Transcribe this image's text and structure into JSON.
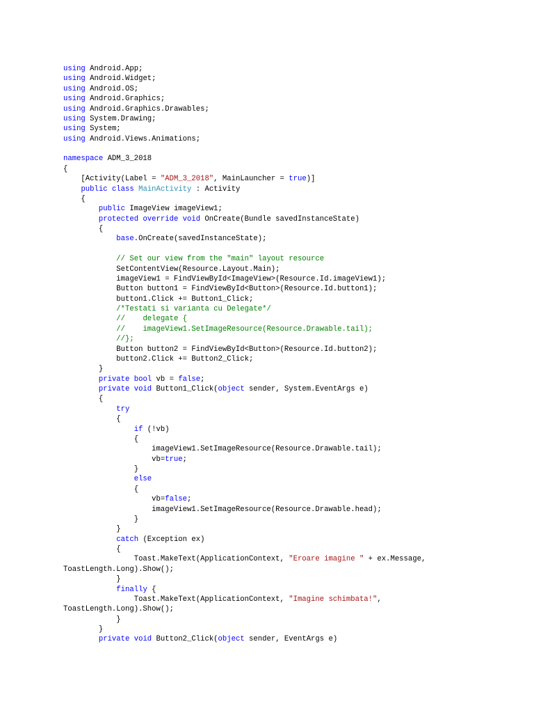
{
  "colors": {
    "keyword": "#0000ff",
    "string": "#a31515",
    "comment": "#008000",
    "type": "#2b91af"
  },
  "lines": [
    [
      [
        "k",
        "using"
      ],
      [
        "p",
        " Android.App;"
      ]
    ],
    [
      [
        "k",
        "using"
      ],
      [
        "p",
        " Android.Widget;"
      ]
    ],
    [
      [
        "k",
        "using"
      ],
      [
        "p",
        " Android.OS;"
      ]
    ],
    [
      [
        "k",
        "using"
      ],
      [
        "p",
        " Android.Graphics;"
      ]
    ],
    [
      [
        "k",
        "using"
      ],
      [
        "p",
        " Android.Graphics.Drawables;"
      ]
    ],
    [
      [
        "k",
        "using"
      ],
      [
        "p",
        " System.Drawing;"
      ]
    ],
    [
      [
        "k",
        "using"
      ],
      [
        "p",
        " System;"
      ]
    ],
    [
      [
        "k",
        "using"
      ],
      [
        "p",
        " Android.Views.Animations;"
      ]
    ],
    [],
    [
      [
        "k",
        "namespace"
      ],
      [
        "p",
        " ADM_3_2018"
      ]
    ],
    [
      [
        "p",
        "{"
      ]
    ],
    [
      [
        "p",
        "    [Activity(Label = "
      ],
      [
        "s",
        "\"ADM_3_2018\""
      ],
      [
        "p",
        ", MainLauncher = "
      ],
      [
        "k",
        "true"
      ],
      [
        "p",
        ")]"
      ]
    ],
    [
      [
        "p",
        "    "
      ],
      [
        "k",
        "public"
      ],
      [
        "p",
        " "
      ],
      [
        "k",
        "class"
      ],
      [
        "p",
        " "
      ],
      [
        "t",
        "MainActivity"
      ],
      [
        "p",
        " : Activity"
      ]
    ],
    [
      [
        "p",
        "    {"
      ]
    ],
    [
      [
        "p",
        "        "
      ],
      [
        "k",
        "public"
      ],
      [
        "p",
        " ImageView imageView1;"
      ]
    ],
    [
      [
        "p",
        "        "
      ],
      [
        "k",
        "protected"
      ],
      [
        "p",
        " "
      ],
      [
        "k",
        "override"
      ],
      [
        "p",
        " "
      ],
      [
        "k",
        "void"
      ],
      [
        "p",
        " OnCreate(Bundle savedInstanceState)"
      ]
    ],
    [
      [
        "p",
        "        {"
      ]
    ],
    [
      [
        "p",
        "            "
      ],
      [
        "k",
        "base"
      ],
      [
        "p",
        ".OnCreate(savedInstanceState);"
      ]
    ],
    [],
    [
      [
        "p",
        "            "
      ],
      [
        "c",
        "// Set our view from the \"main\" layout resource"
      ]
    ],
    [
      [
        "p",
        "            SetContentView(Resource.Layout.Main);"
      ]
    ],
    [
      [
        "p",
        "            imageView1 = FindViewById<ImageView>(Resource.Id.imageView1);"
      ]
    ],
    [
      [
        "p",
        "            Button button1 = FindViewById<Button>(Resource.Id.button1);"
      ]
    ],
    [
      [
        "p",
        "            button1.Click += Button1_Click;"
      ]
    ],
    [
      [
        "p",
        "            "
      ],
      [
        "c",
        "/*Testati si varianta cu Delegate*/"
      ]
    ],
    [
      [
        "p",
        "            "
      ],
      [
        "c",
        "//    delegate {"
      ]
    ],
    [
      [
        "p",
        "            "
      ],
      [
        "c",
        "//    imageView1.SetImageResource(Resource.Drawable.tail);"
      ]
    ],
    [
      [
        "p",
        "            "
      ],
      [
        "c",
        "//};"
      ]
    ],
    [
      [
        "p",
        "            Button button2 = FindViewById<Button>(Resource.Id.button2);"
      ]
    ],
    [
      [
        "p",
        "            button2.Click += Button2_Click;"
      ]
    ],
    [
      [
        "p",
        "        }"
      ]
    ],
    [
      [
        "p",
        "        "
      ],
      [
        "k",
        "private"
      ],
      [
        "p",
        " "
      ],
      [
        "k",
        "bool"
      ],
      [
        "p",
        " vb = "
      ],
      [
        "k",
        "false"
      ],
      [
        "p",
        ";"
      ]
    ],
    [
      [
        "p",
        "        "
      ],
      [
        "k",
        "private"
      ],
      [
        "p",
        " "
      ],
      [
        "k",
        "void"
      ],
      [
        "p",
        " Button1_Click("
      ],
      [
        "k",
        "object"
      ],
      [
        "p",
        " sender, System.EventArgs e)"
      ]
    ],
    [
      [
        "p",
        "        {"
      ]
    ],
    [
      [
        "p",
        "            "
      ],
      [
        "k",
        "try"
      ]
    ],
    [
      [
        "p",
        "            {"
      ]
    ],
    [
      [
        "p",
        "                "
      ],
      [
        "k",
        "if"
      ],
      [
        "p",
        " (!vb)"
      ]
    ],
    [
      [
        "p",
        "                {"
      ]
    ],
    [
      [
        "p",
        "                    imageView1.SetImageResource(Resource.Drawable.tail);"
      ]
    ],
    [
      [
        "p",
        "                    vb="
      ],
      [
        "k",
        "true"
      ],
      [
        "p",
        ";"
      ]
    ],
    [
      [
        "p",
        "                }"
      ]
    ],
    [
      [
        "p",
        "                "
      ],
      [
        "k",
        "else"
      ]
    ],
    [
      [
        "p",
        "                {"
      ]
    ],
    [
      [
        "p",
        "                    vb="
      ],
      [
        "k",
        "false"
      ],
      [
        "p",
        ";"
      ]
    ],
    [
      [
        "p",
        "                    imageView1.SetImageResource(Resource.Drawable.head);"
      ]
    ],
    [
      [
        "p",
        "                }"
      ]
    ],
    [
      [
        "p",
        "            }"
      ]
    ],
    [
      [
        "p",
        "            "
      ],
      [
        "k",
        "catch"
      ],
      [
        "p",
        " (Exception ex)"
      ]
    ],
    [
      [
        "p",
        "            {"
      ]
    ],
    [
      [
        "p",
        "                Toast.MakeText(ApplicationContext, "
      ],
      [
        "s",
        "\"Eroare imagine \""
      ],
      [
        "p",
        " + ex.Message,"
      ]
    ],
    [
      [
        "p",
        "ToastLength.Long).Show();"
      ]
    ],
    [
      [
        "p",
        "            }"
      ]
    ],
    [
      [
        "p",
        "            "
      ],
      [
        "k",
        "finally"
      ],
      [
        "p",
        " {"
      ]
    ],
    [
      [
        "p",
        "                Toast.MakeText(ApplicationContext, "
      ],
      [
        "s",
        "\"Imagine schimbata!\""
      ],
      [
        "p",
        ","
      ]
    ],
    [
      [
        "p",
        "ToastLength.Long).Show();"
      ]
    ],
    [
      [
        "p",
        "            }"
      ]
    ],
    [
      [
        "p",
        "        }"
      ]
    ],
    [
      [
        "p",
        "        "
      ],
      [
        "k",
        "private"
      ],
      [
        "p",
        " "
      ],
      [
        "k",
        "void"
      ],
      [
        "p",
        " Button2_Click("
      ],
      [
        "k",
        "object"
      ],
      [
        "p",
        " sender, EventArgs e)"
      ]
    ]
  ]
}
